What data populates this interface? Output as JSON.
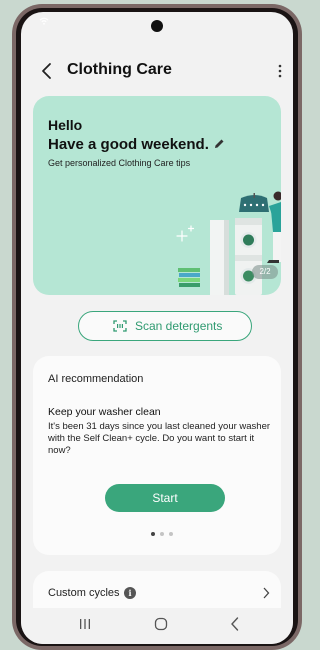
{
  "app_bar": {
    "title": "Clothing Care"
  },
  "hero": {
    "greeting": "Hello",
    "message": "Have a good weekend.",
    "tips": "Get personalized Clothing Care tips",
    "page_indicator": "2/2"
  },
  "scan": {
    "label": "Scan detergents"
  },
  "ai_card": {
    "header": "AI recommendation",
    "title": "Keep your washer clean",
    "description": "It's been 31 days since you last cleaned your washer with the Self Clean+ cycle. Do you want to start it now?",
    "button_label": "Start",
    "pager": {
      "current": 1,
      "total": 3
    }
  },
  "custom_cycles": {
    "label": "Custom cycles"
  },
  "colors": {
    "accent": "#3aa67c",
    "hero_bg": "#b5e6d4",
    "card_bg": "#fbfbfb",
    "screen_bg": "#f2f2f2",
    "frame": "#7b6866"
  },
  "icons": [
    "wifi-icon",
    "back-icon",
    "more-vert-icon",
    "edit-pencil-icon",
    "scan-barcode-icon",
    "info-icon",
    "chevron-right-icon",
    "nav-recent-icon",
    "nav-home-icon",
    "nav-back-icon"
  ]
}
